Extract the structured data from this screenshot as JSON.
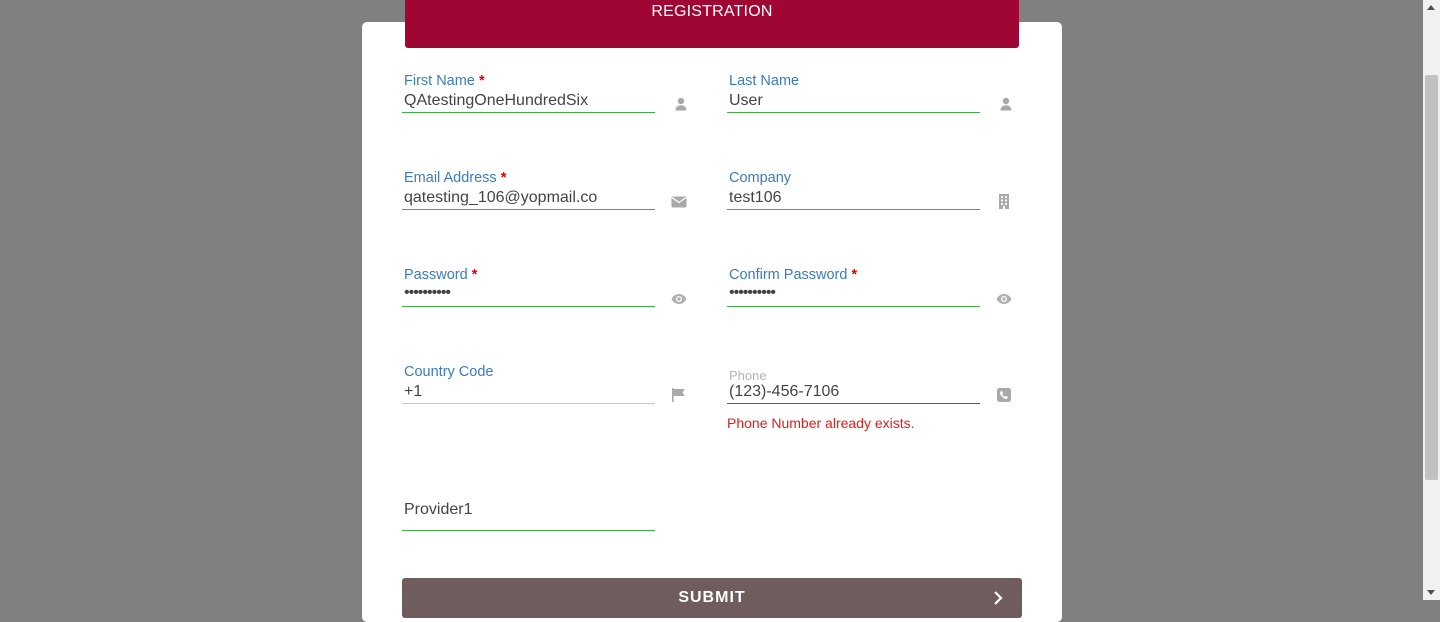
{
  "header": {
    "title": "REGISTRATION"
  },
  "fields": {
    "first_name": {
      "label": "First Name",
      "required": "*",
      "value": "QAtestingOneHundredSix",
      "icon": "user-icon"
    },
    "last_name": {
      "label": "Last Name",
      "value": "User",
      "icon": "user-icon"
    },
    "email": {
      "label": "Email Address",
      "required": "*",
      "value": "qatesting_106@yopmail.co",
      "icon": "envelope-icon"
    },
    "company": {
      "label": "Company",
      "value": "test106",
      "icon": "building-icon"
    },
    "password": {
      "label": "Password",
      "required": "*",
      "value": "••••••••••",
      "icon": "eye-icon"
    },
    "confirm_password": {
      "label": "Confirm Password",
      "required": "*",
      "value": "••••••••••",
      "icon": "eye-icon"
    },
    "country_code": {
      "label": "Country Code",
      "value": "+1",
      "icon": "flag-icon"
    },
    "phone": {
      "placeholder": "Phone",
      "value": "(123)-456-7106",
      "error": "Phone Number already exists.",
      "icon": "phone-icon"
    },
    "provider": {
      "value": "Provider1"
    }
  },
  "submit": {
    "label": "SUBMIT",
    "icon": "chevron-right-icon"
  },
  "colors": {
    "header": "#a00634",
    "label": "#3b7bbf",
    "valid_line": "#3fae49",
    "error": "#e01e1e",
    "submit": "#6f5c5c"
  }
}
